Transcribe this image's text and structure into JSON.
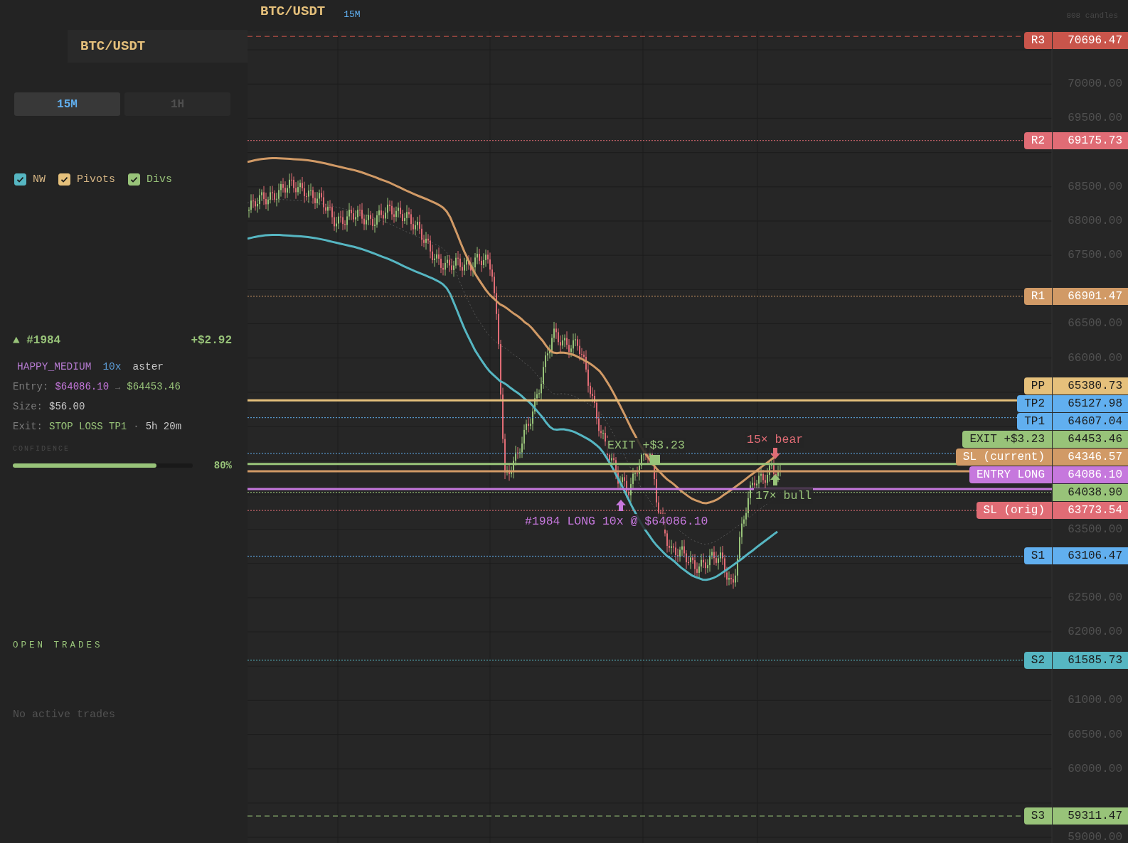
{
  "sidebar": {
    "pair": "BTC/USDT",
    "tabs": [
      {
        "label": "15M",
        "selected": true
      },
      {
        "label": "1H",
        "selected": false
      }
    ],
    "toggles": [
      {
        "label": "NW",
        "checked": true,
        "color": "#56b6c2"
      },
      {
        "label": "Pivots",
        "checked": true,
        "color": "#e5c07b"
      },
      {
        "label": "Divs",
        "checked": true,
        "color": "#98c379"
      }
    ],
    "trade": {
      "direction": "▲",
      "id": "#1984",
      "pnl": "+$2.92",
      "strategy": "HAPPY_MEDIUM",
      "leverage": "10x",
      "exchange": "aster",
      "entry_label": "Entry:",
      "entry_price": "$64086.10",
      "arrow": "→",
      "exit_price": "$64453.46",
      "size_label": "Size:",
      "size": "$56.00",
      "exit_label": "Exit:",
      "exit_reason": "STOP LOSS TP1",
      "separator": "·",
      "duration": "5h 20m",
      "confidence_label": "CONFIDENCE",
      "confidence": {
        "level": 0.8,
        "reading": "80%"
      }
    },
    "open_trades": {
      "title": "OPEN TRADES",
      "empty": "No active trades"
    }
  },
  "chart": {
    "header": {
      "pair": "BTC/USDT",
      "timeframe": "15M",
      "candle_count": "808 candles"
    },
    "ticks": [
      "70000.00",
      "69500.00",
      "68500.00",
      "68000.00",
      "67500.00",
      "66500.00",
      "66000.00",
      "63500.00",
      "62500.00",
      "62000.00",
      "61000.00",
      "60500.00",
      "60000.00",
      "59000.00"
    ],
    "levels": [
      {
        "tag": "R3",
        "value": "70696.47",
        "color": "#c9554b",
        "kind": "dashed"
      },
      {
        "tag": "R2",
        "value": "69175.73",
        "color": "#e06c75",
        "kind": "dotted"
      },
      {
        "tag": "R1",
        "value": "66901.47",
        "color": "#d19a66",
        "kind": "dotted"
      },
      {
        "tag": "PP",
        "value": "65380.73",
        "color": "#e5c07b",
        "kind": "solid"
      },
      {
        "tag": "TP2",
        "value": "65127.98",
        "color": "#61afef",
        "kind": "dotted"
      },
      {
        "tag": "TP1",
        "value": "64607.04",
        "color": "#61afef",
        "kind": "dotted"
      },
      {
        "tag": "EXIT +$3.23",
        "value": "64453.46",
        "color": "#98c379",
        "kind": "solid"
      },
      {
        "tag": "SL (current)",
        "value": "64346.57",
        "color": "#d19a66",
        "kind": "solid"
      },
      {
        "tag": "ENTRY LONG",
        "value": "64086.10",
        "color": "#c678dd",
        "kind": "solid"
      },
      {
        "value": "64038.90",
        "color": "#98c379",
        "kind": "dotted"
      },
      {
        "tag": "SL (orig)",
        "value": "63773.54",
        "color": "#e06c75",
        "kind": "dotted"
      },
      {
        "tag": "S1",
        "value": "63106.47",
        "color": "#61afef",
        "kind": "dotted"
      },
      {
        "tag": "S2",
        "value": "61585.73",
        "color": "#56b6c2",
        "kind": "dotted"
      },
      {
        "tag": "S3",
        "value": "59311.47",
        "color": "#98c379",
        "kind": "dashed"
      }
    ],
    "annotations": [
      {
        "kind": "text",
        "text": "EXIT +$3.23",
        "color": "#98c379"
      },
      {
        "kind": "square",
        "color": "#98c379"
      },
      {
        "kind": "text",
        "text": "15× bear",
        "color": "#e06c75"
      },
      {
        "kind": "down",
        "color": "#e06c75"
      },
      {
        "kind": "up",
        "color": "#98c379"
      },
      {
        "kind": "text",
        "text": "17× bull",
        "color": "#98c379"
      },
      {
        "kind": "up",
        "color": "#c678dd"
      },
      {
        "kind": "text",
        "text": "#1984 LONG 10x @ $64086.10",
        "color": "#c678dd"
      }
    ]
  }
}
